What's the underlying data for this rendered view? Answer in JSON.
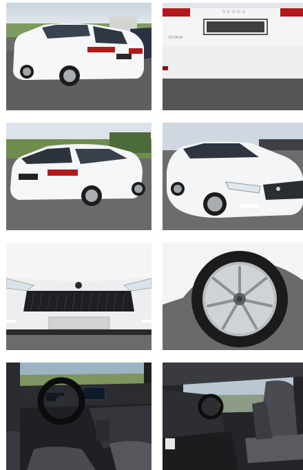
{
  "gallery": {
    "photos": [
      {
        "alt": "white-estate-rear-three-quarter-view"
      },
      {
        "alt": "white-estate-tailgate-closeup"
      },
      {
        "alt": "white-estate-rear-three-quarter-view-2"
      },
      {
        "alt": "white-estate-front-three-quarter-view"
      },
      {
        "alt": "white-estate-front-grille-closeup"
      },
      {
        "alt": "white-estate-alloy-wheel-closeup"
      },
      {
        "alt": "interior-dashboard-view"
      },
      {
        "alt": "interior-front-seats-view"
      }
    ],
    "tailgate_brand": "SKODA",
    "tailgate_model": "OCTAVIA"
  }
}
